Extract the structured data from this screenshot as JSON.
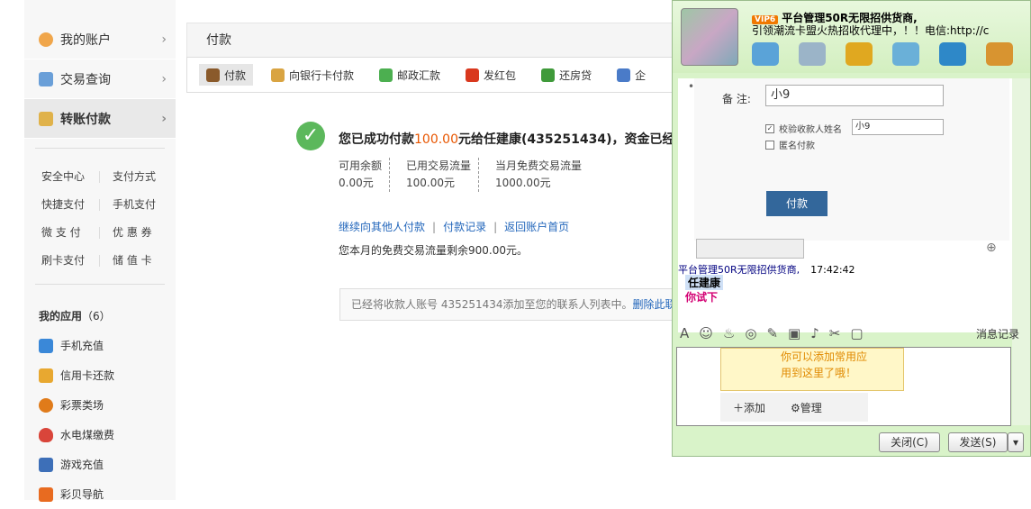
{
  "sidebar": {
    "nav": [
      {
        "label": "我的账户",
        "icon": "user-icon",
        "color": "#f0a64b"
      },
      {
        "label": "交易查询",
        "icon": "document-icon",
        "color": "#6a9fd8"
      },
      {
        "label": "转账付款",
        "icon": "transfer-icon",
        "color": "#e0b24a"
      }
    ],
    "quick_links": [
      "安全中心",
      "支付方式",
      "快捷支付",
      "手机支付",
      "微 支 付",
      "优 惠 券",
      "刷卡支付",
      "储 值 卡"
    ],
    "apps_title": "我的应用",
    "apps_count": "（6）",
    "apps": [
      {
        "label": "手机充值",
        "icon": "phone-topup-icon",
        "color": "#3a88d8"
      },
      {
        "label": "信用卡还款",
        "icon": "credit-card-icon",
        "color": "#e8a830"
      },
      {
        "label": "彩票类场",
        "icon": "lottery-icon",
        "color": "#e07b1a"
      },
      {
        "label": "水电煤缴费",
        "icon": "flame-icon",
        "color": "#d9453a"
      },
      {
        "label": "游戏充值",
        "icon": "gamepad-icon",
        "color": "#3d6fb8"
      },
      {
        "label": "彩贝导航",
        "icon": "caibei-icon",
        "color": "#e86b20"
      }
    ]
  },
  "main": {
    "title": "付款",
    "tabs": [
      {
        "label": "付款",
        "icon": "pay-icon",
        "color": "#8a5a2b"
      },
      {
        "label": "向银行卡付款",
        "icon": "bank-card-icon",
        "color": "#d9a442"
      },
      {
        "label": "邮政汇款",
        "icon": "postal-icon",
        "color": "#4caf50"
      },
      {
        "label": "发红包",
        "icon": "red-packet-icon",
        "color": "#d9381e"
      },
      {
        "label": "还房贷",
        "icon": "house-icon",
        "color": "#3f9a3a"
      },
      {
        "label": "企",
        "icon": "enterprise-icon",
        "color": "#4a7bc8"
      }
    ],
    "success_prefix": "您已成功付款",
    "amount": "100.00",
    "success_suffix": "元给任建康(435251434)，资金已经",
    "stats": [
      {
        "label": "可用余额",
        "value": "0.00元"
      },
      {
        "label": "已用交易流量",
        "value": "100.00元"
      },
      {
        "label": "当月免费交易流量",
        "value": "1000.00元"
      }
    ],
    "links": [
      "继续向其他人付款",
      "付款记录",
      "返回账户首页"
    ],
    "remaining_note": "您本月的免费交易流量剩余900.00元。",
    "contact_note": "已经将收款人账号 435251434添加至您的联系人列表中。",
    "contact_delete": "删除此联系"
  },
  "chat": {
    "vip_badge": "VIP6",
    "contact_name": "平台管理50R无限招供货商,",
    "signature": "引领潮流卡盟火热招收代理中，！！电信:http://c",
    "remark_label": "备  注:",
    "remark_value": "小9",
    "verify_label": "校验收款人姓名",
    "verify_value": "小9",
    "anon_label": "匿名付款",
    "pay_button": "付款",
    "sender": "平台管理50R无限招供货商,",
    "time": "17:42:42",
    "message_1": "任建康",
    "message_2": "你试下",
    "tip_text_1": "你可以添加常用应",
    "tip_text_2": "用到这里了哦！",
    "tip_add": "添加",
    "tip_manage": "管理",
    "records_label": "消息记录",
    "close_button": "关闭(C)",
    "send_button": "发送(S)"
  }
}
